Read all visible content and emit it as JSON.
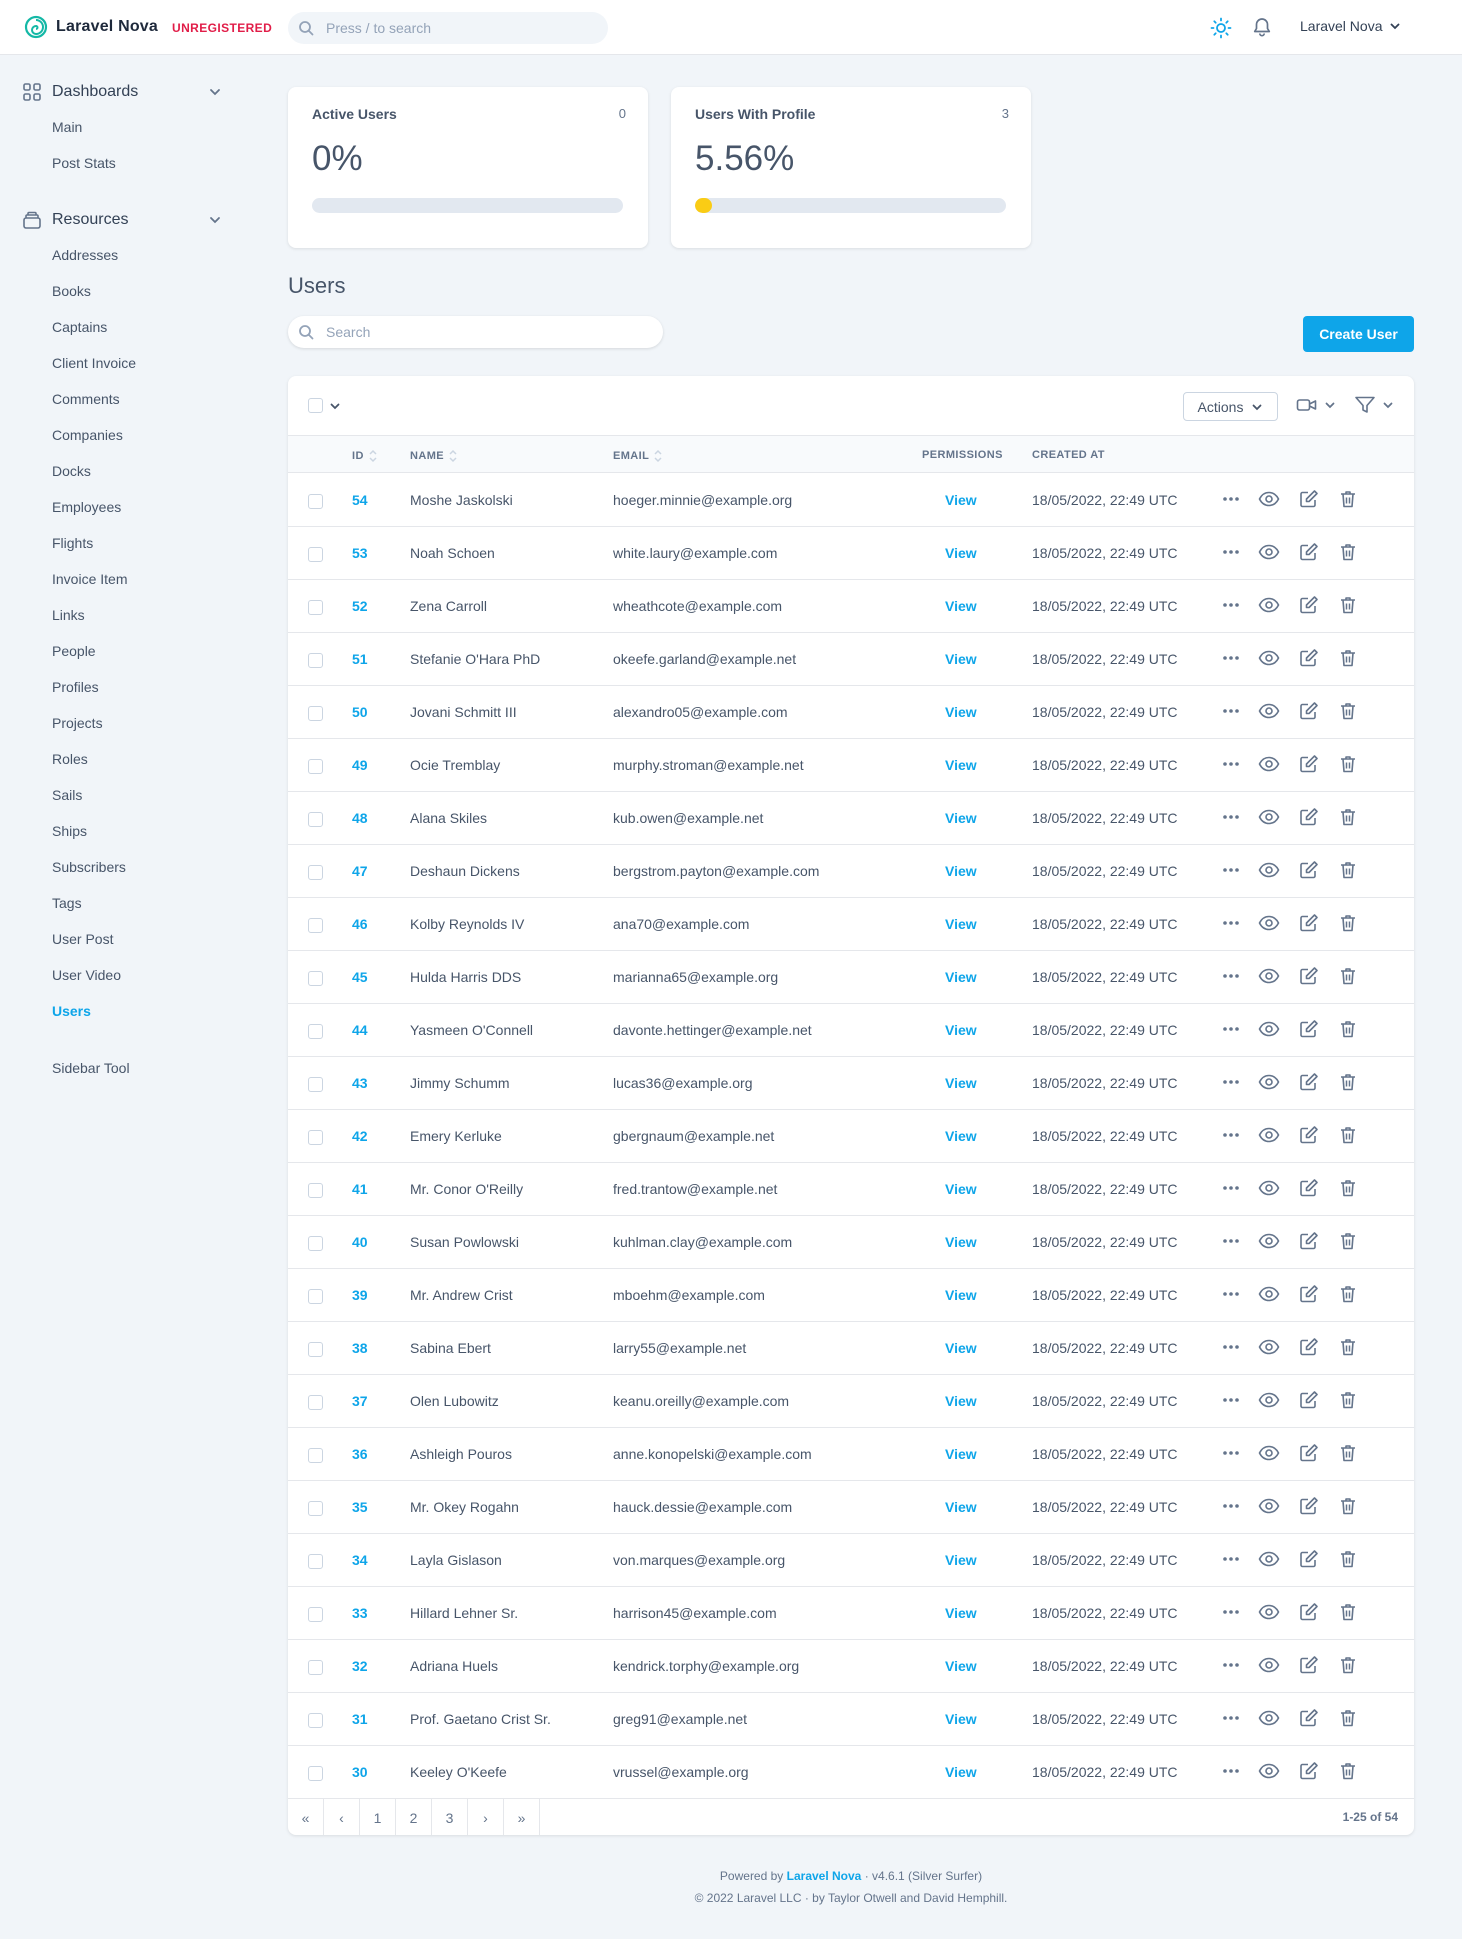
{
  "header": {
    "logo_text": "Laravel Nova",
    "badge": "UNREGISTERED",
    "search_placeholder": "Press / to search",
    "user_label": "Laravel Nova"
  },
  "sidebar": {
    "dashboards_label": "Dashboards",
    "dashboards": [
      "Main",
      "Post Stats"
    ],
    "resources_label": "Resources",
    "resources": [
      "Addresses",
      "Books",
      "Captains",
      "Client Invoice",
      "Comments",
      "Companies",
      "Docks",
      "Employees",
      "Flights",
      "Invoice Item",
      "Links",
      "People",
      "Profiles",
      "Projects",
      "Roles",
      "Sails",
      "Ships",
      "Subscribers",
      "Tags",
      "User Post",
      "User Video",
      "Users"
    ],
    "active": "Users",
    "tools": [
      "Sidebar Tool"
    ]
  },
  "metrics": [
    {
      "title": "Active Users",
      "count": "0",
      "value": "0%",
      "progress": 0.0
    },
    {
      "title": "Users With Profile",
      "count": "3",
      "value": "5.56%",
      "progress": 0.0556
    }
  ],
  "page": {
    "title": "Users",
    "search_placeholder": "Search",
    "create_button": "Create User"
  },
  "table": {
    "actions_label": "Actions",
    "columns": {
      "id": "ID",
      "name": "NAME",
      "email": "EMAIL",
      "permissions": "PERMISSIONS",
      "created": "CREATED AT"
    },
    "rows": [
      {
        "id": "54",
        "name": "Moshe Jaskolski",
        "email": "hoeger.minnie@example.org",
        "perm": "View",
        "created": "18/05/2022, 22:49 UTC"
      },
      {
        "id": "53",
        "name": "Noah Schoen",
        "email": "white.laury@example.com",
        "perm": "View",
        "created": "18/05/2022, 22:49 UTC"
      },
      {
        "id": "52",
        "name": "Zena Carroll",
        "email": "wheathcote@example.com",
        "perm": "View",
        "created": "18/05/2022, 22:49 UTC"
      },
      {
        "id": "51",
        "name": "Stefanie O'Hara PhD",
        "email": "okeefe.garland@example.net",
        "perm": "View",
        "created": "18/05/2022, 22:49 UTC"
      },
      {
        "id": "50",
        "name": "Jovani Schmitt III",
        "email": "alexandro05@example.com",
        "perm": "View",
        "created": "18/05/2022, 22:49 UTC"
      },
      {
        "id": "49",
        "name": "Ocie Tremblay",
        "email": "murphy.stroman@example.net",
        "perm": "View",
        "created": "18/05/2022, 22:49 UTC"
      },
      {
        "id": "48",
        "name": "Alana Skiles",
        "email": "kub.owen@example.net",
        "perm": "View",
        "created": "18/05/2022, 22:49 UTC"
      },
      {
        "id": "47",
        "name": "Deshaun Dickens",
        "email": "bergstrom.payton@example.com",
        "perm": "View",
        "created": "18/05/2022, 22:49 UTC"
      },
      {
        "id": "46",
        "name": "Kolby Reynolds IV",
        "email": "ana70@example.com",
        "perm": "View",
        "created": "18/05/2022, 22:49 UTC"
      },
      {
        "id": "45",
        "name": "Hulda Harris DDS",
        "email": "marianna65@example.org",
        "perm": "View",
        "created": "18/05/2022, 22:49 UTC"
      },
      {
        "id": "44",
        "name": "Yasmeen O'Connell",
        "email": "davonte.hettinger@example.net",
        "perm": "View",
        "created": "18/05/2022, 22:49 UTC"
      },
      {
        "id": "43",
        "name": "Jimmy Schumm",
        "email": "lucas36@example.org",
        "perm": "View",
        "created": "18/05/2022, 22:49 UTC"
      },
      {
        "id": "42",
        "name": "Emery Kerluke",
        "email": "gbergnaum@example.net",
        "perm": "View",
        "created": "18/05/2022, 22:49 UTC"
      },
      {
        "id": "41",
        "name": "Mr. Conor O'Reilly",
        "email": "fred.trantow@example.net",
        "perm": "View",
        "created": "18/05/2022, 22:49 UTC"
      },
      {
        "id": "40",
        "name": "Susan Powlowski",
        "email": "kuhlman.clay@example.com",
        "perm": "View",
        "created": "18/05/2022, 22:49 UTC"
      },
      {
        "id": "39",
        "name": "Mr. Andrew Crist",
        "email": "mboehm@example.com",
        "perm": "View",
        "created": "18/05/2022, 22:49 UTC"
      },
      {
        "id": "38",
        "name": "Sabina Ebert",
        "email": "larry55@example.net",
        "perm": "View",
        "created": "18/05/2022, 22:49 UTC"
      },
      {
        "id": "37",
        "name": "Olen Lubowitz",
        "email": "keanu.oreilly@example.com",
        "perm": "View",
        "created": "18/05/2022, 22:49 UTC"
      },
      {
        "id": "36",
        "name": "Ashleigh Pouros",
        "email": "anne.konopelski@example.com",
        "perm": "View",
        "created": "18/05/2022, 22:49 UTC"
      },
      {
        "id": "35",
        "name": "Mr. Okey Rogahn",
        "email": "hauck.dessie@example.com",
        "perm": "View",
        "created": "18/05/2022, 22:49 UTC"
      },
      {
        "id": "34",
        "name": "Layla Gislason",
        "email": "von.marques@example.org",
        "perm": "View",
        "created": "18/05/2022, 22:49 UTC"
      },
      {
        "id": "33",
        "name": "Hillard Lehner Sr.",
        "email": "harrison45@example.com",
        "perm": "View",
        "created": "18/05/2022, 22:49 UTC"
      },
      {
        "id": "32",
        "name": "Adriana Huels",
        "email": "kendrick.torphy@example.org",
        "perm": "View",
        "created": "18/05/2022, 22:49 UTC"
      },
      {
        "id": "31",
        "name": "Prof. Gaetano Crist Sr.",
        "email": "greg91@example.net",
        "perm": "View",
        "created": "18/05/2022, 22:49 UTC"
      },
      {
        "id": "30",
        "name": "Keeley O'Keefe",
        "email": "vrussel@example.org",
        "perm": "View",
        "created": "18/05/2022, 22:49 UTC"
      }
    ],
    "pagination": {
      "first": "«",
      "prev": "‹",
      "pages": [
        "1",
        "2",
        "3"
      ],
      "next": "›",
      "last": "»",
      "info": "1-25 of 54"
    }
  },
  "footer": {
    "powered_prefix": "Powered by",
    "powered_link": "Laravel Nova",
    "version": "· v4.6.1 (Silver Surfer)",
    "copyright": "© 2022 Laravel LLC · by Taylor Otwell and David Hemphill."
  },
  "colors": {
    "accent": "#0ea5e9",
    "badge": "#e11d48",
    "progress": "#facc15"
  }
}
